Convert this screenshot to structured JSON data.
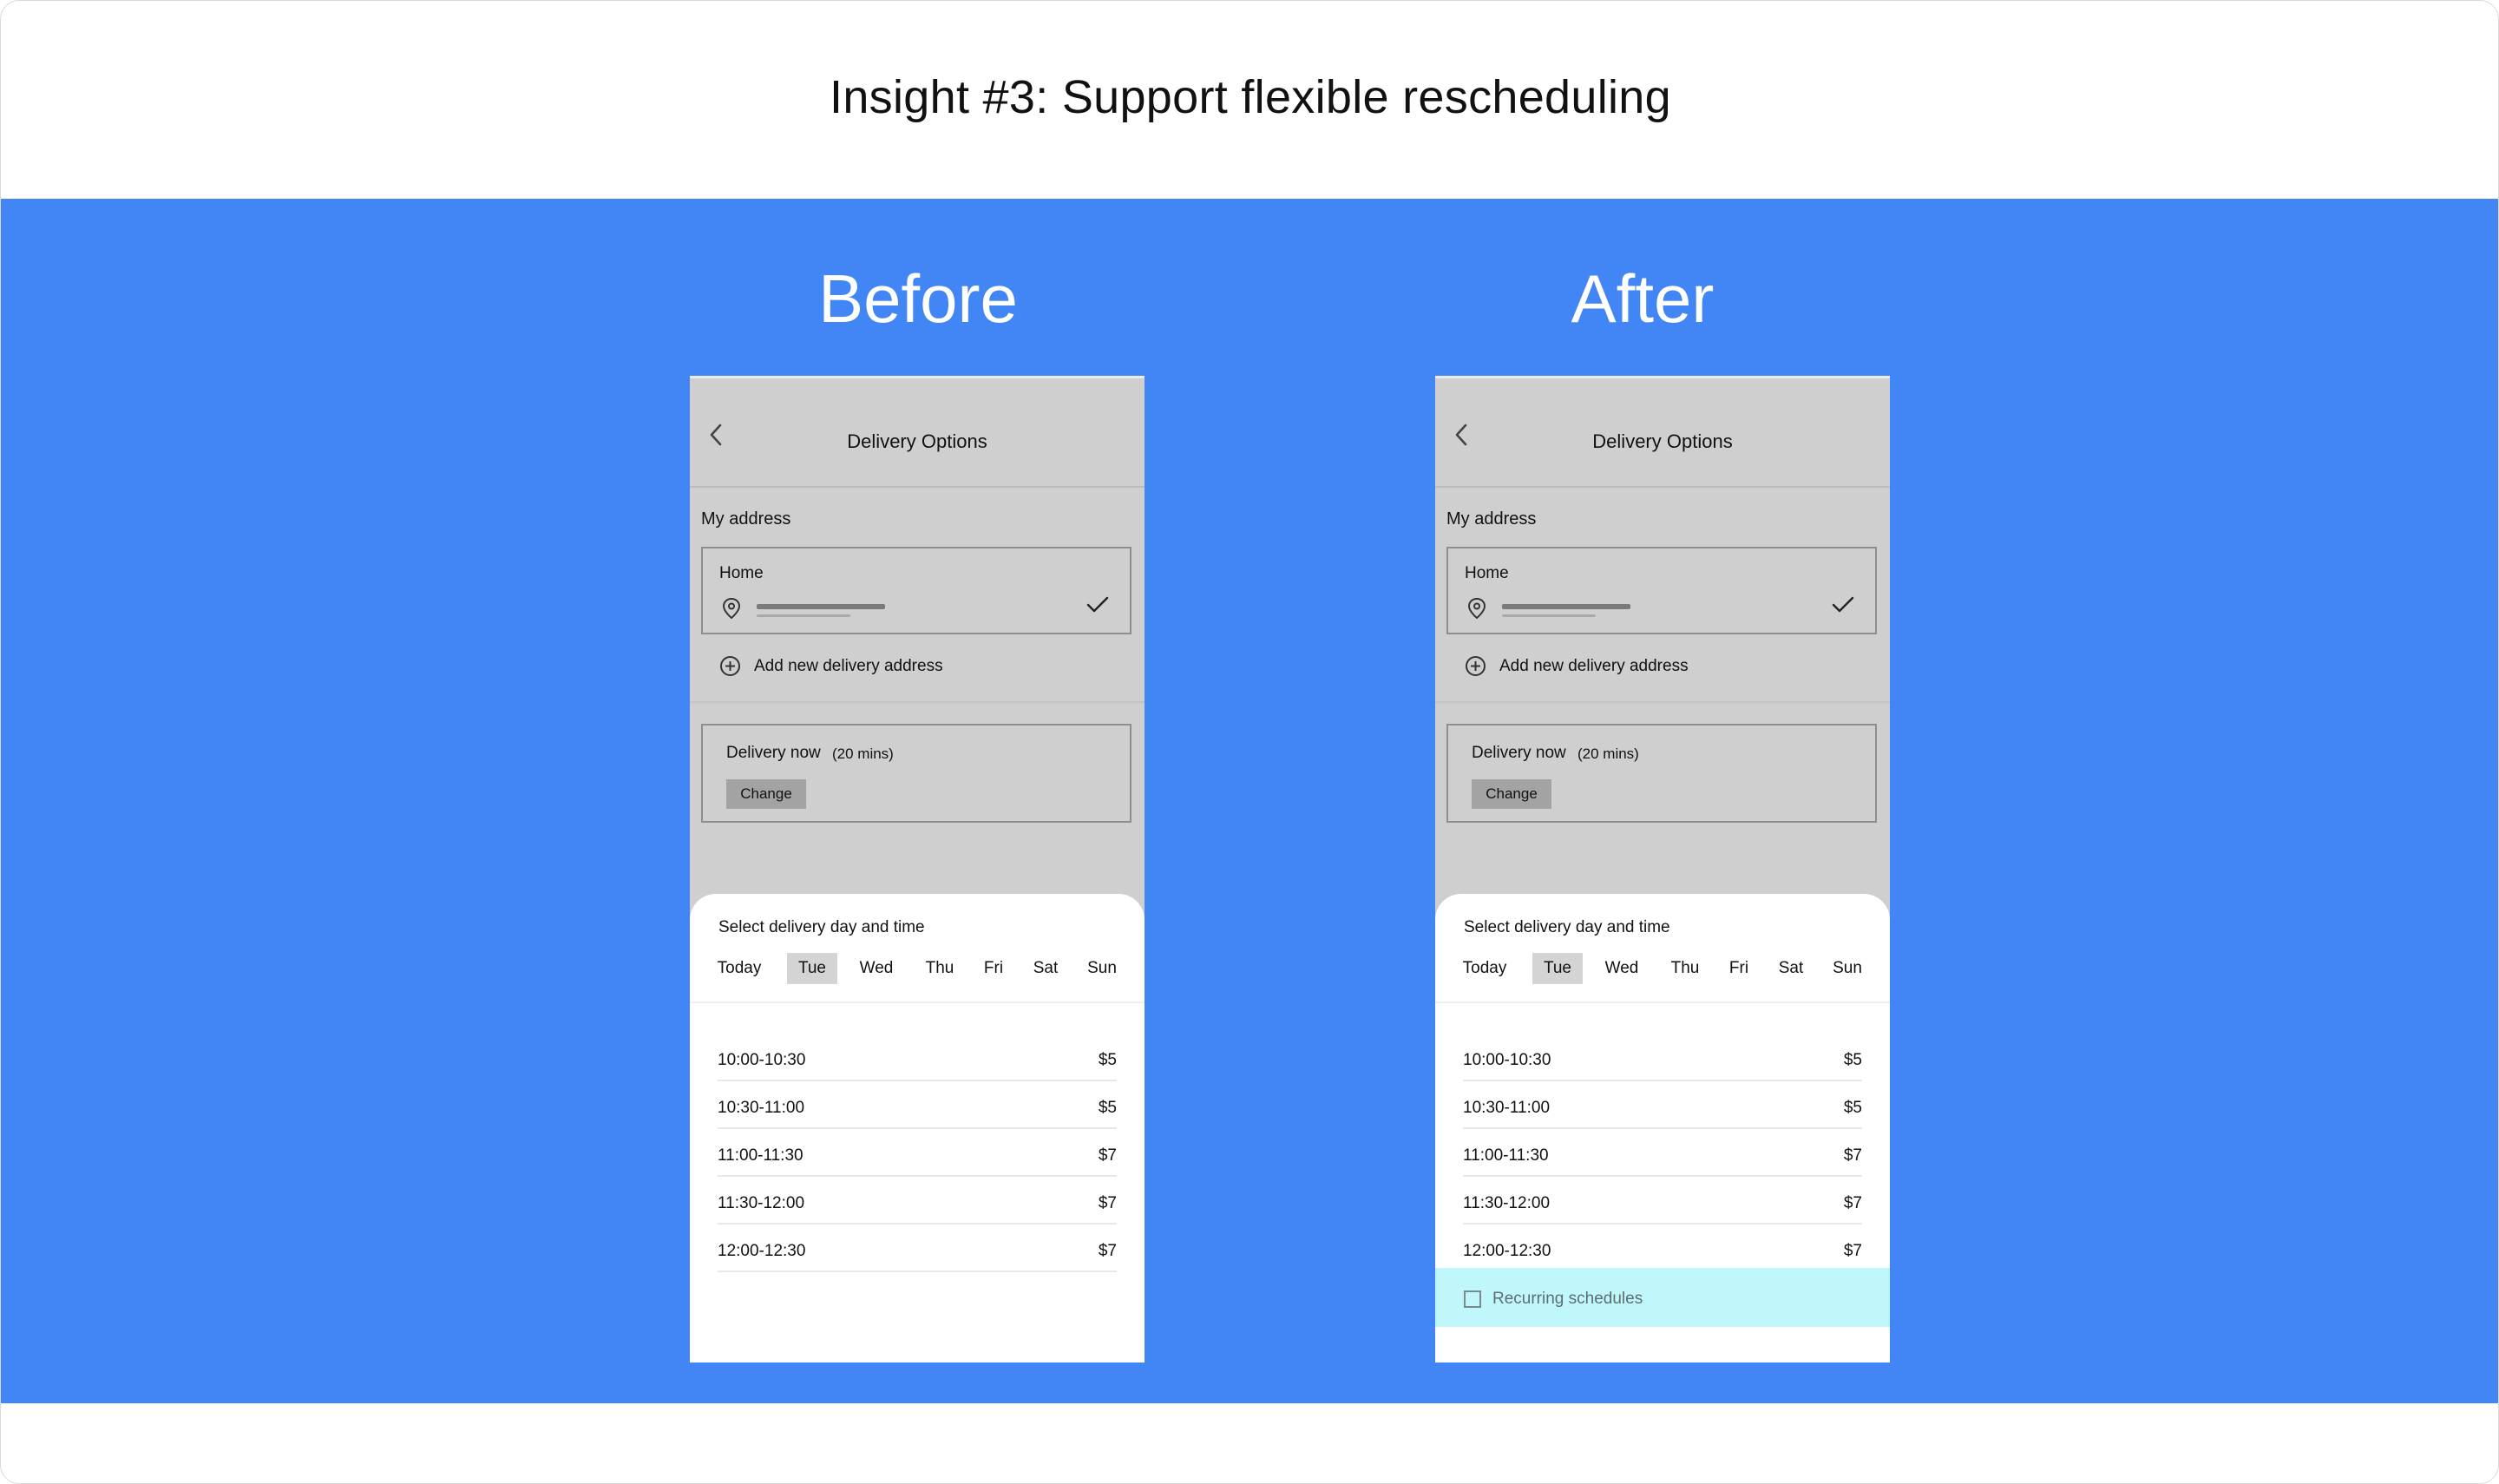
{
  "page": {
    "title": "Insight #3: Support flexible rescheduling",
    "band_color": "#4286f5",
    "highlight_color": "#bff7fb"
  },
  "before": {
    "label": "Before",
    "screen": {
      "header_title": "Delivery Options",
      "back_icon": "chevron-left-icon",
      "my_address_label": "My address",
      "address": {
        "name": "Home",
        "pin_icon": "location-pin-icon",
        "selected_icon": "check-icon"
      },
      "add_address_label": "Add new delivery address",
      "delivery": {
        "now_label": "Delivery now",
        "eta": "(20 mins)",
        "change_label": "Change"
      },
      "sheet": {
        "title": "Select delivery day and time",
        "days": [
          "Today",
          "Tue",
          "Wed",
          "Thu",
          "Fri",
          "Sat",
          "Sun"
        ],
        "selected_day": "Tue",
        "slots": [
          {
            "time": "10:00-10:30",
            "price": "$5"
          },
          {
            "time": "10:30-11:00",
            "price": "$5"
          },
          {
            "time": "11:00-11:30",
            "price": "$7"
          },
          {
            "time": "11:30-12:00",
            "price": "$7"
          },
          {
            "time": "12:00-12:30",
            "price": "$7"
          }
        ]
      }
    }
  },
  "after": {
    "label": "After",
    "screen": {
      "header_title": "Delivery Options",
      "back_icon": "chevron-left-icon",
      "my_address_label": "My address",
      "address": {
        "name": "Home",
        "pin_icon": "location-pin-icon",
        "selected_icon": "check-icon"
      },
      "add_address_label": "Add new delivery address",
      "delivery": {
        "now_label": "Delivery now",
        "eta": "(20 mins)",
        "change_label": "Change"
      },
      "sheet": {
        "title": "Select delivery day and time",
        "days": [
          "Today",
          "Tue",
          "Wed",
          "Thu",
          "Fri",
          "Sat",
          "Sun"
        ],
        "selected_day": "Tue",
        "slots": [
          {
            "time": "10:00-10:30",
            "price": "$5"
          },
          {
            "time": "10:30-11:00",
            "price": "$5"
          },
          {
            "time": "11:00-11:30",
            "price": "$7"
          },
          {
            "time": "11:30-12:00",
            "price": "$7"
          },
          {
            "time": "12:00-12:30",
            "price": "$7"
          }
        ],
        "recurring": {
          "label": "Recurring schedules",
          "checked": false
        }
      }
    }
  }
}
